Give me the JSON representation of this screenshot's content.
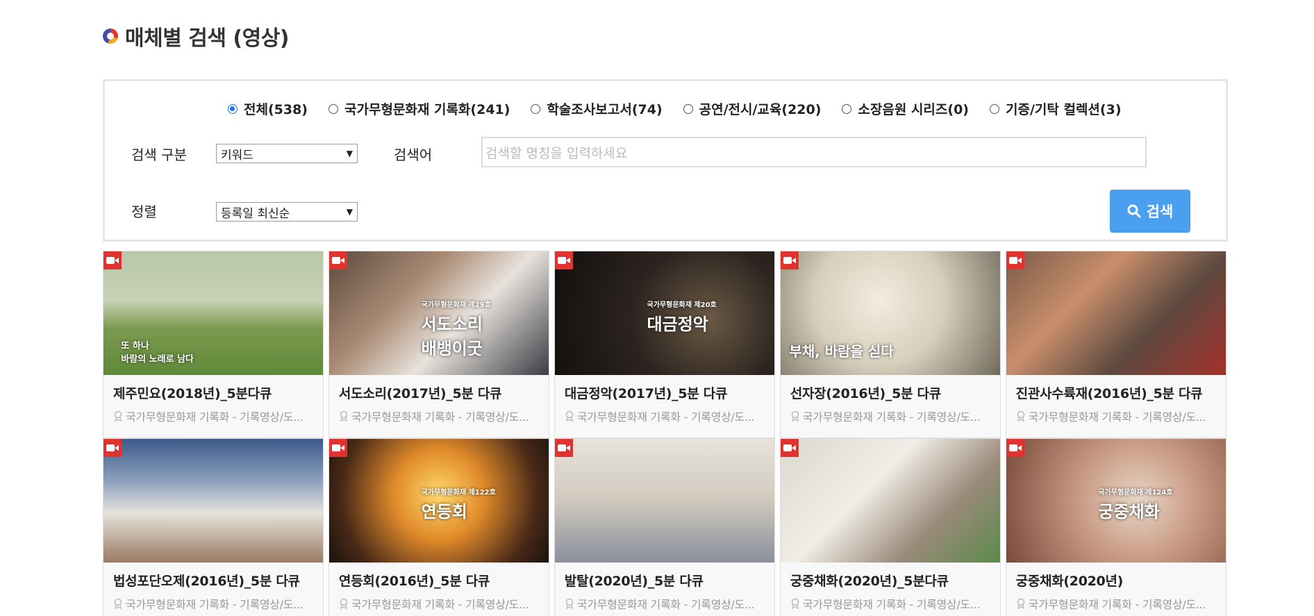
{
  "page": {
    "title": "매체별 검색 (영상)"
  },
  "filters": {
    "categories": [
      {
        "label": "전체(538)",
        "checked": true
      },
      {
        "label": "국가무형문화재 기록화(241)",
        "checked": false
      },
      {
        "label": "학술조사보고서(74)",
        "checked": false
      },
      {
        "label": "공연/전시/교육(220)",
        "checked": false
      },
      {
        "label": "소장음원 시리즈(0)",
        "checked": false
      },
      {
        "label": "기증/기탁 컬렉션(3)",
        "checked": false
      }
    ],
    "search_type_label": "검색 구분",
    "search_type_value": "키워드",
    "keyword_label": "검색어",
    "keyword_placeholder": "검색할 명칭을 입력하세요",
    "sort_label": "정렬",
    "sort_value": "등록일 최신순",
    "search_button": "검색"
  },
  "videos": [
    {
      "title": "제주민요(2018년)_5분다큐",
      "category": "국가무형문화재 기록화 - 기록영상/도...",
      "caption": "또 하나\n바람의 노래로 남다"
    },
    {
      "title": "서도소리(2017년)_5분 다큐",
      "category": "국가무형문화재 기록화 - 기록영상/도...",
      "caption": "서도소리\n배뱅이굿",
      "small": "국가무형문화재 제29호"
    },
    {
      "title": "대금정악(2017년)_5분 다큐",
      "category": "국가무형문화재 기록화 - 기록영상/도...",
      "caption": "대금정악",
      "small": "국가무형문화재 제20호"
    },
    {
      "title": "선자장(2016년)_5분 다큐",
      "category": "국가무형문화재 기록화 - 기록영상/도...",
      "caption": "부채, 바람을 싣다"
    },
    {
      "title": "진관사수륙재(2016년)_5분 다큐",
      "category": "국가무형문화재 기록화 - 기록영상/도...",
      "caption": ""
    },
    {
      "title": "법성포단오제(2016년)_5분 다큐",
      "category": "국가무형문화재 기록화 - 기록영상/도...",
      "caption": ""
    },
    {
      "title": "연등회(2016년)_5분 다큐",
      "category": "국가무형문화재 기록화 - 기록영상/도...",
      "caption": "연등회",
      "small": "국가무형문화재 제122호"
    },
    {
      "title": "발탈(2020년)_5분 다큐",
      "category": "국가무형문화재 기록화 - 기록영상/도...",
      "caption": ""
    },
    {
      "title": "궁중채화(2020년)_5분다큐",
      "category": "국가무형문화재 기록화 - 기록영상/도...",
      "caption": ""
    },
    {
      "title": "궁중채화(2020년)",
      "category": "국가무형문화재 기록화 - 기록영상/도...",
      "caption": "궁중채화",
      "small": "국가무형문화재 제124호"
    }
  ],
  "colors": {
    "accent": "#4a9ff0",
    "badge": "#e0322f",
    "radio_checked": "#1a73e8"
  },
  "icons": {
    "video": "video-camera-icon",
    "search": "search-icon",
    "award": "award-icon"
  }
}
